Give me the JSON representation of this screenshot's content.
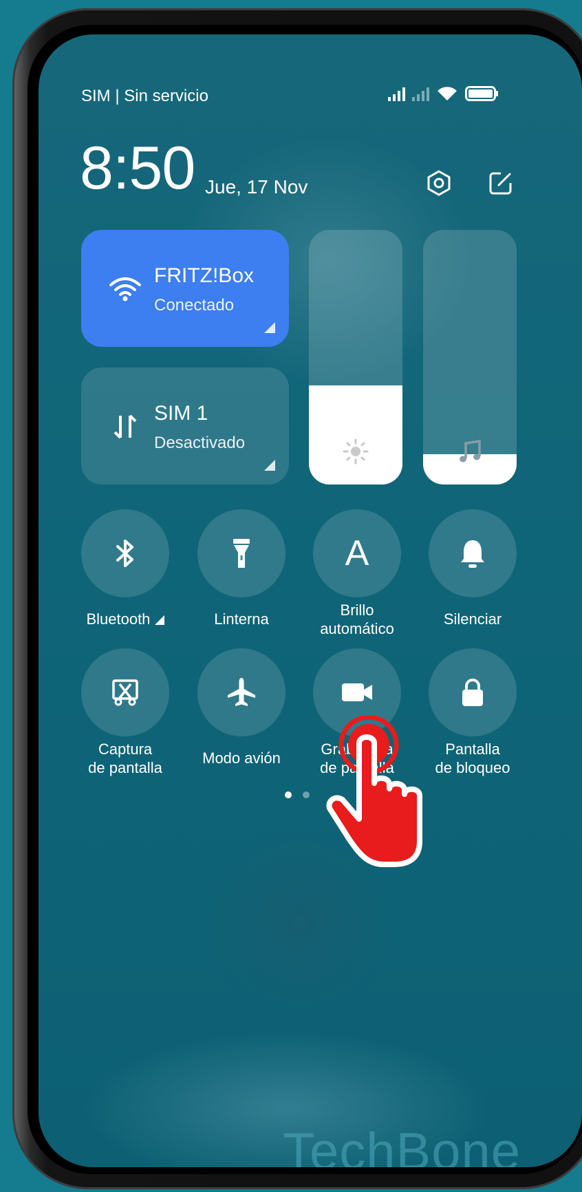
{
  "status_bar": {
    "carrier": "SIM | Sin servicio",
    "icons": [
      "signal-strength-icon",
      "signal-off-icon",
      "wifi-icon",
      "battery-icon"
    ]
  },
  "header": {
    "time": "8:50",
    "date": "Jue, 17 Nov",
    "buttons": [
      "settings-icon",
      "edit-icon"
    ]
  },
  "tiles": {
    "wifi": {
      "title": "FRITZ!Box",
      "subtitle": "Conectado",
      "active": true,
      "icon": "wifi-icon"
    },
    "mobile_data": {
      "title": "SIM 1",
      "subtitle": "Desactivado",
      "active": false,
      "icon": "data-arrows-icon"
    }
  },
  "sliders": {
    "brightness": {
      "level": 0.39,
      "icon": "sun-icon"
    },
    "volume": {
      "level": 0.12,
      "icon": "music-note-icon"
    }
  },
  "toggles": [
    {
      "label": "Bluetooth",
      "icon": "bluetooth-icon"
    },
    {
      "label": "Linterna",
      "icon": "flashlight-icon"
    },
    {
      "label": "Brillo automático",
      "icon": "auto-brightness-icon",
      "glyph": "A"
    },
    {
      "label": "Silenciar",
      "icon": "bell-icon"
    },
    {
      "label": "Captura de pantalla",
      "icon": "screenshot-icon"
    },
    {
      "label": "Modo avión",
      "icon": "airplane-icon"
    },
    {
      "label": "Grabadora de pantalla",
      "icon": "video-camera-icon"
    },
    {
      "label": "Pantalla de bloqueo",
      "icon": "lock-icon"
    }
  ],
  "pager": {
    "pages": 2,
    "current": 1
  },
  "overlay": {
    "icon": "tap-hand-icon"
  },
  "watermark": "TechBone",
  "colors": {
    "background": "#157b8e",
    "screen": "#0f6578",
    "wifi_tile": "#3d7ef0",
    "tap_red": "#e81c1c"
  }
}
